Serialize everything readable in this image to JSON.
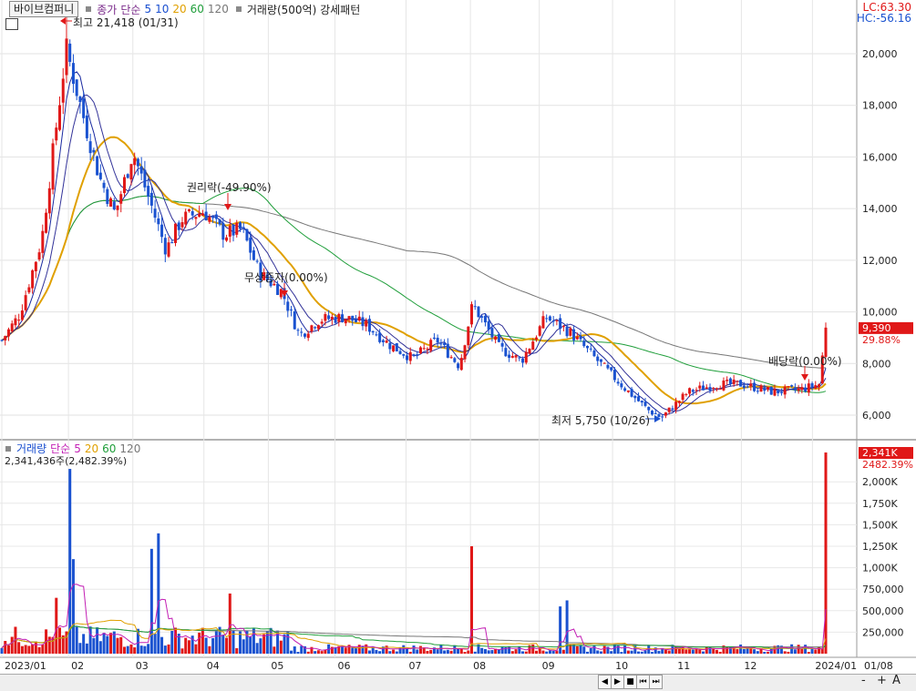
{
  "header": {
    "stock_name": "바이브컴퍼니",
    "price_label": "종가",
    "ma_type": "단순",
    "ma_periods": [
      "5",
      "10",
      "20",
      "60",
      "120"
    ],
    "volume_legend": "거래량(500억) 강세패턴"
  },
  "hud": {
    "lc": "LC:63.30",
    "hc": "HC:-56.16"
  },
  "price_axis": {
    "ticks": [
      "20,000",
      "18,000",
      "16,000",
      "14,000",
      "12,000",
      "10,000",
      "8,000",
      "6,000"
    ],
    "current_price": "9,390",
    "current_change": "29.88%"
  },
  "annotations": {
    "high": "최고 21,418 (01/31)",
    "low": "최저 5,750 (10/26)",
    "rights": "권리락(-49.90%)",
    "free_issue": "무상증자(0.00%)",
    "dividend": "배당락(0.00%)"
  },
  "volume_panel": {
    "label": "거래량",
    "ma_type": "단순",
    "ma_periods": [
      "5",
      "20",
      "60",
      "120"
    ],
    "total": "2,341,436주(2,482.39%)",
    "current": "2,341K",
    "current_pct": "2482.39%",
    "ticks": [
      "2,000K",
      "1,750K",
      "1,500K",
      "1,250K",
      "1,000K",
      "750,000",
      "500,000",
      "250,000"
    ]
  },
  "date_axis": [
    "2023/01",
    "02",
    "03",
    "04",
    "05",
    "06",
    "07",
    "08",
    "09",
    "10",
    "11",
    "12",
    "2024/01",
    "01/08"
  ],
  "nav": {
    "buttons": [
      "◀",
      "▶",
      "■",
      "⏮",
      "⏭"
    ],
    "zoom": [
      "-",
      "+",
      "A"
    ]
  },
  "colors": {
    "up": "#e01818",
    "down": "#1a52d0",
    "ma5": "#1a2aa0",
    "ma20": "#e0a000",
    "ma60": "#1f9e3a",
    "ma120": "#777777",
    "vol_ma5": "#c21eb4"
  },
  "chart_data": [
    {
      "type": "candlestick",
      "title": "바이브컴퍼니",
      "ylim": [
        5500,
        21500
      ],
      "series": [
        {
          "name": "종가",
          "points": [
            {
              "x": "2023/01/02",
              "y": 8900
            },
            {
              "x": "2023/01/10",
              "y": 9900
            },
            {
              "x": "2023/01/20",
              "y": 12800
            },
            {
              "x": "2023/01/31",
              "y": 20200
            },
            {
              "x": "2023/02/07",
              "y": 17800
            },
            {
              "x": "2023/02/15",
              "y": 15200
            },
            {
              "x": "2023/02/22",
              "y": 13800
            },
            {
              "x": "2023/03/02",
              "y": 16200
            },
            {
              "x": "2023/03/10",
              "y": 14200
            },
            {
              "x": "2023/03/17",
              "y": 12400
            },
            {
              "x": "2023/03/24",
              "y": 13600
            },
            {
              "x": "2023/04/03",
              "y": 13900
            },
            {
              "x": "2023/04/12",
              "y": 13000
            },
            {
              "x": "2023/04/20",
              "y": 13200
            },
            {
              "x": "2023/04/28",
              "y": 11500
            },
            {
              "x": "2023/05/08",
              "y": 10800
            },
            {
              "x": "2023/05/16",
              "y": 9100
            },
            {
              "x": "2023/05/25",
              "y": 9700
            },
            {
              "x": "2023/06/05",
              "y": 9800
            },
            {
              "x": "2023/06/15",
              "y": 9500
            },
            {
              "x": "2023/06/26",
              "y": 8700
            },
            {
              "x": "2023/07/06",
              "y": 8200
            },
            {
              "x": "2023/07/17",
              "y": 8900
            },
            {
              "x": "2023/07/27",
              "y": 7900
            },
            {
              "x": "2023/08/02",
              "y": 10300
            },
            {
              "x": "2023/08/14",
              "y": 8600
            },
            {
              "x": "2023/08/24",
              "y": 8100
            },
            {
              "x": "2023/09/04",
              "y": 9800
            },
            {
              "x": "2023/09/15",
              "y": 9200
            },
            {
              "x": "2023/09/25",
              "y": 8300
            },
            {
              "x": "2023/10/10",
              "y": 7000
            },
            {
              "x": "2023/10/20",
              "y": 6200
            },
            {
              "x": "2023/10/26",
              "y": 5900
            },
            {
              "x": "2023/11/07",
              "y": 6900
            },
            {
              "x": "2023/11/20",
              "y": 7200
            },
            {
              "x": "2023/12/01",
              "y": 7200
            },
            {
              "x": "2023/12/15",
              "y": 6900
            },
            {
              "x": "2023/12/28",
              "y": 7000
            },
            {
              "x": "2024/01/05",
              "y": 7200
            },
            {
              "x": "2024/01/08",
              "y": 9390
            }
          ]
        }
      ]
    },
    {
      "type": "bar",
      "title": "거래량",
      "ylim": [
        0,
        2400
      ],
      "series": [
        {
          "name": "거래량(K)",
          "points": [
            {
              "x": "2023/01/26",
              "y": 650
            },
            {
              "x": "2023/02/01",
              "y": 2150
            },
            {
              "x": "2023/02/03",
              "y": 1100
            },
            {
              "x": "2023/03/10",
              "y": 1220
            },
            {
              "x": "2023/03/13",
              "y": 1400
            },
            {
              "x": "2023/04/14",
              "y": 700
            },
            {
              "x": "2023/08/01",
              "y": 1250
            },
            {
              "x": "2023/09/11",
              "y": 550
            },
            {
              "x": "2023/09/13",
              "y": 620
            },
            {
              "x": "2024/01/08",
              "y": 2341
            }
          ]
        }
      ]
    }
  ]
}
